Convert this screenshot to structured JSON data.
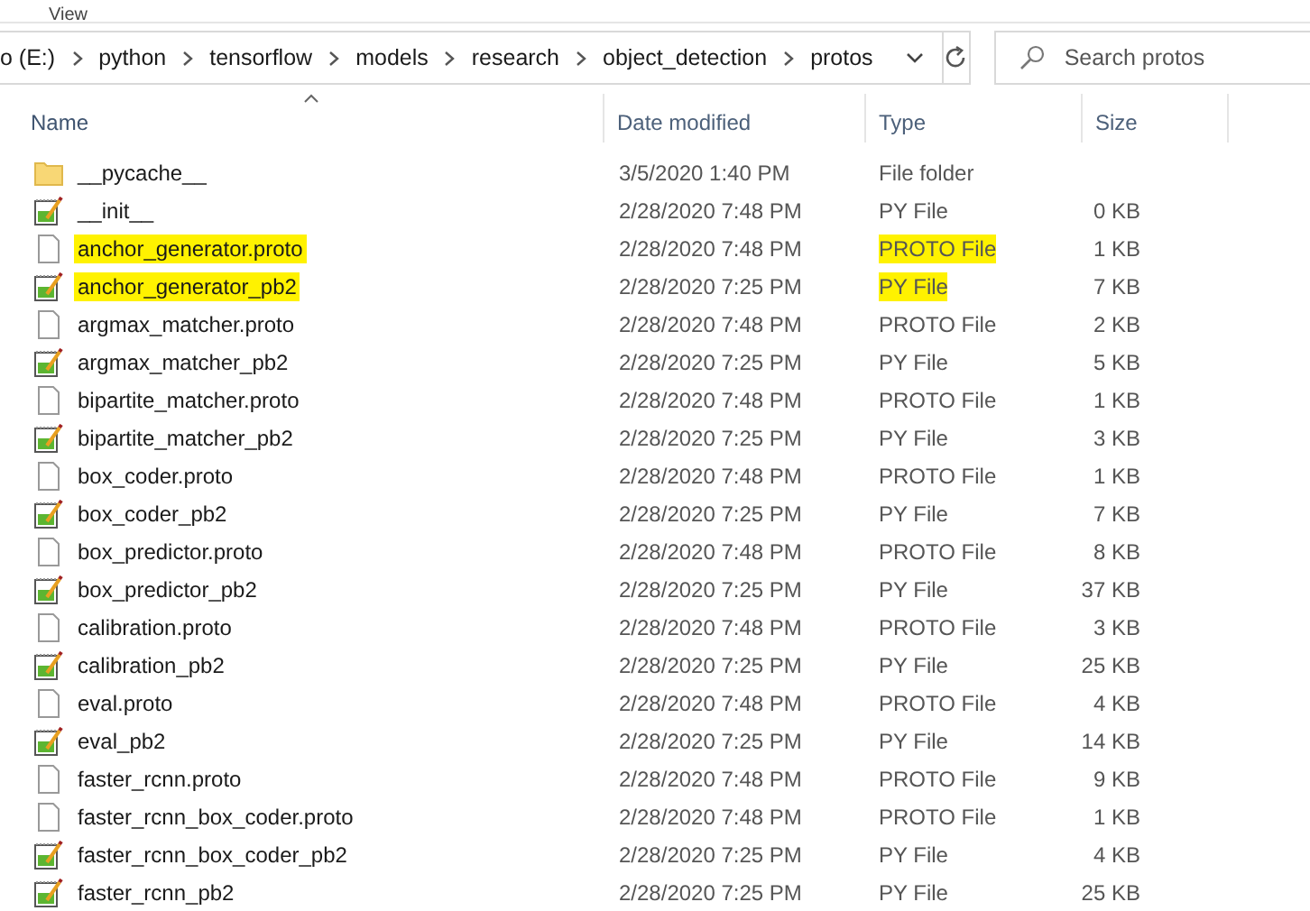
{
  "ribbon": {
    "tab": "View"
  },
  "address_bar": {
    "crumbs": [
      "o (E:)",
      "python",
      "tensorflow",
      "models",
      "research",
      "object_detection",
      "protos"
    ]
  },
  "search": {
    "placeholder": "Search protos"
  },
  "columns": [
    {
      "label": "Name",
      "sorted": true
    },
    {
      "label": "Date modified",
      "sorted": false
    },
    {
      "label": "Type",
      "sorted": false
    },
    {
      "label": "Size",
      "sorted": false
    }
  ],
  "rows": [
    {
      "kind": "folder",
      "name": "__pycache__",
      "name_highlighted": false,
      "date": "3/5/2020 1:40 PM",
      "type": "File folder",
      "type_highlighted": false,
      "size": ""
    },
    {
      "kind": "py",
      "name": "__init__",
      "name_highlighted": false,
      "date": "2/28/2020 7:48 PM",
      "type": "PY File",
      "type_highlighted": false,
      "size": "0 KB"
    },
    {
      "kind": "proto",
      "name": "anchor_generator.proto",
      "name_highlighted": true,
      "date": "2/28/2020 7:48 PM",
      "type": "PROTO File",
      "type_highlighted": true,
      "size": "1 KB"
    },
    {
      "kind": "py",
      "name": "anchor_generator_pb2",
      "name_highlighted": true,
      "date": "2/28/2020 7:25 PM",
      "type": "PY File",
      "type_highlighted": true,
      "size": "7 KB"
    },
    {
      "kind": "proto",
      "name": "argmax_matcher.proto",
      "name_highlighted": false,
      "date": "2/28/2020 7:48 PM",
      "type": "PROTO File",
      "type_highlighted": false,
      "size": "2 KB"
    },
    {
      "kind": "py",
      "name": "argmax_matcher_pb2",
      "name_highlighted": false,
      "date": "2/28/2020 7:25 PM",
      "type": "PY File",
      "type_highlighted": false,
      "size": "5 KB"
    },
    {
      "kind": "proto",
      "name": "bipartite_matcher.proto",
      "name_highlighted": false,
      "date": "2/28/2020 7:48 PM",
      "type": "PROTO File",
      "type_highlighted": false,
      "size": "1 KB"
    },
    {
      "kind": "py",
      "name": "bipartite_matcher_pb2",
      "name_highlighted": false,
      "date": "2/28/2020 7:25 PM",
      "type": "PY File",
      "type_highlighted": false,
      "size": "3 KB"
    },
    {
      "kind": "proto",
      "name": "box_coder.proto",
      "name_highlighted": false,
      "date": "2/28/2020 7:48 PM",
      "type": "PROTO File",
      "type_highlighted": false,
      "size": "1 KB"
    },
    {
      "kind": "py",
      "name": "box_coder_pb2",
      "name_highlighted": false,
      "date": "2/28/2020 7:25 PM",
      "type": "PY File",
      "type_highlighted": false,
      "size": "7 KB"
    },
    {
      "kind": "proto",
      "name": "box_predictor.proto",
      "name_highlighted": false,
      "date": "2/28/2020 7:48 PM",
      "type": "PROTO File",
      "type_highlighted": false,
      "size": "8 KB"
    },
    {
      "kind": "py",
      "name": "box_predictor_pb2",
      "name_highlighted": false,
      "date": "2/28/2020 7:25 PM",
      "type": "PY File",
      "type_highlighted": false,
      "size": "37 KB"
    },
    {
      "kind": "proto",
      "name": "calibration.proto",
      "name_highlighted": false,
      "date": "2/28/2020 7:48 PM",
      "type": "PROTO File",
      "type_highlighted": false,
      "size": "3 KB"
    },
    {
      "kind": "py",
      "name": "calibration_pb2",
      "name_highlighted": false,
      "date": "2/28/2020 7:25 PM",
      "type": "PY File",
      "type_highlighted": false,
      "size": "25 KB"
    },
    {
      "kind": "proto",
      "name": "eval.proto",
      "name_highlighted": false,
      "date": "2/28/2020 7:48 PM",
      "type": "PROTO File",
      "type_highlighted": false,
      "size": "4 KB"
    },
    {
      "kind": "py",
      "name": "eval_pb2",
      "name_highlighted": false,
      "date": "2/28/2020 7:25 PM",
      "type": "PY File",
      "type_highlighted": false,
      "size": "14 KB"
    },
    {
      "kind": "proto",
      "name": "faster_rcnn.proto",
      "name_highlighted": false,
      "date": "2/28/2020 7:48 PM",
      "type": "PROTO File",
      "type_highlighted": false,
      "size": "9 KB"
    },
    {
      "kind": "proto",
      "name": "faster_rcnn_box_coder.proto",
      "name_highlighted": false,
      "date": "2/28/2020 7:48 PM",
      "type": "PROTO File",
      "type_highlighted": false,
      "size": "1 KB"
    },
    {
      "kind": "py",
      "name": "faster_rcnn_box_coder_pb2",
      "name_highlighted": false,
      "date": "2/28/2020 7:25 PM",
      "type": "PY File",
      "type_highlighted": false,
      "size": "4 KB"
    },
    {
      "kind": "py",
      "name": "faster_rcnn_pb2",
      "name_highlighted": false,
      "date": "2/28/2020 7:25 PM",
      "type": "PY File",
      "type_highlighted": false,
      "size": "25 KB"
    }
  ]
}
